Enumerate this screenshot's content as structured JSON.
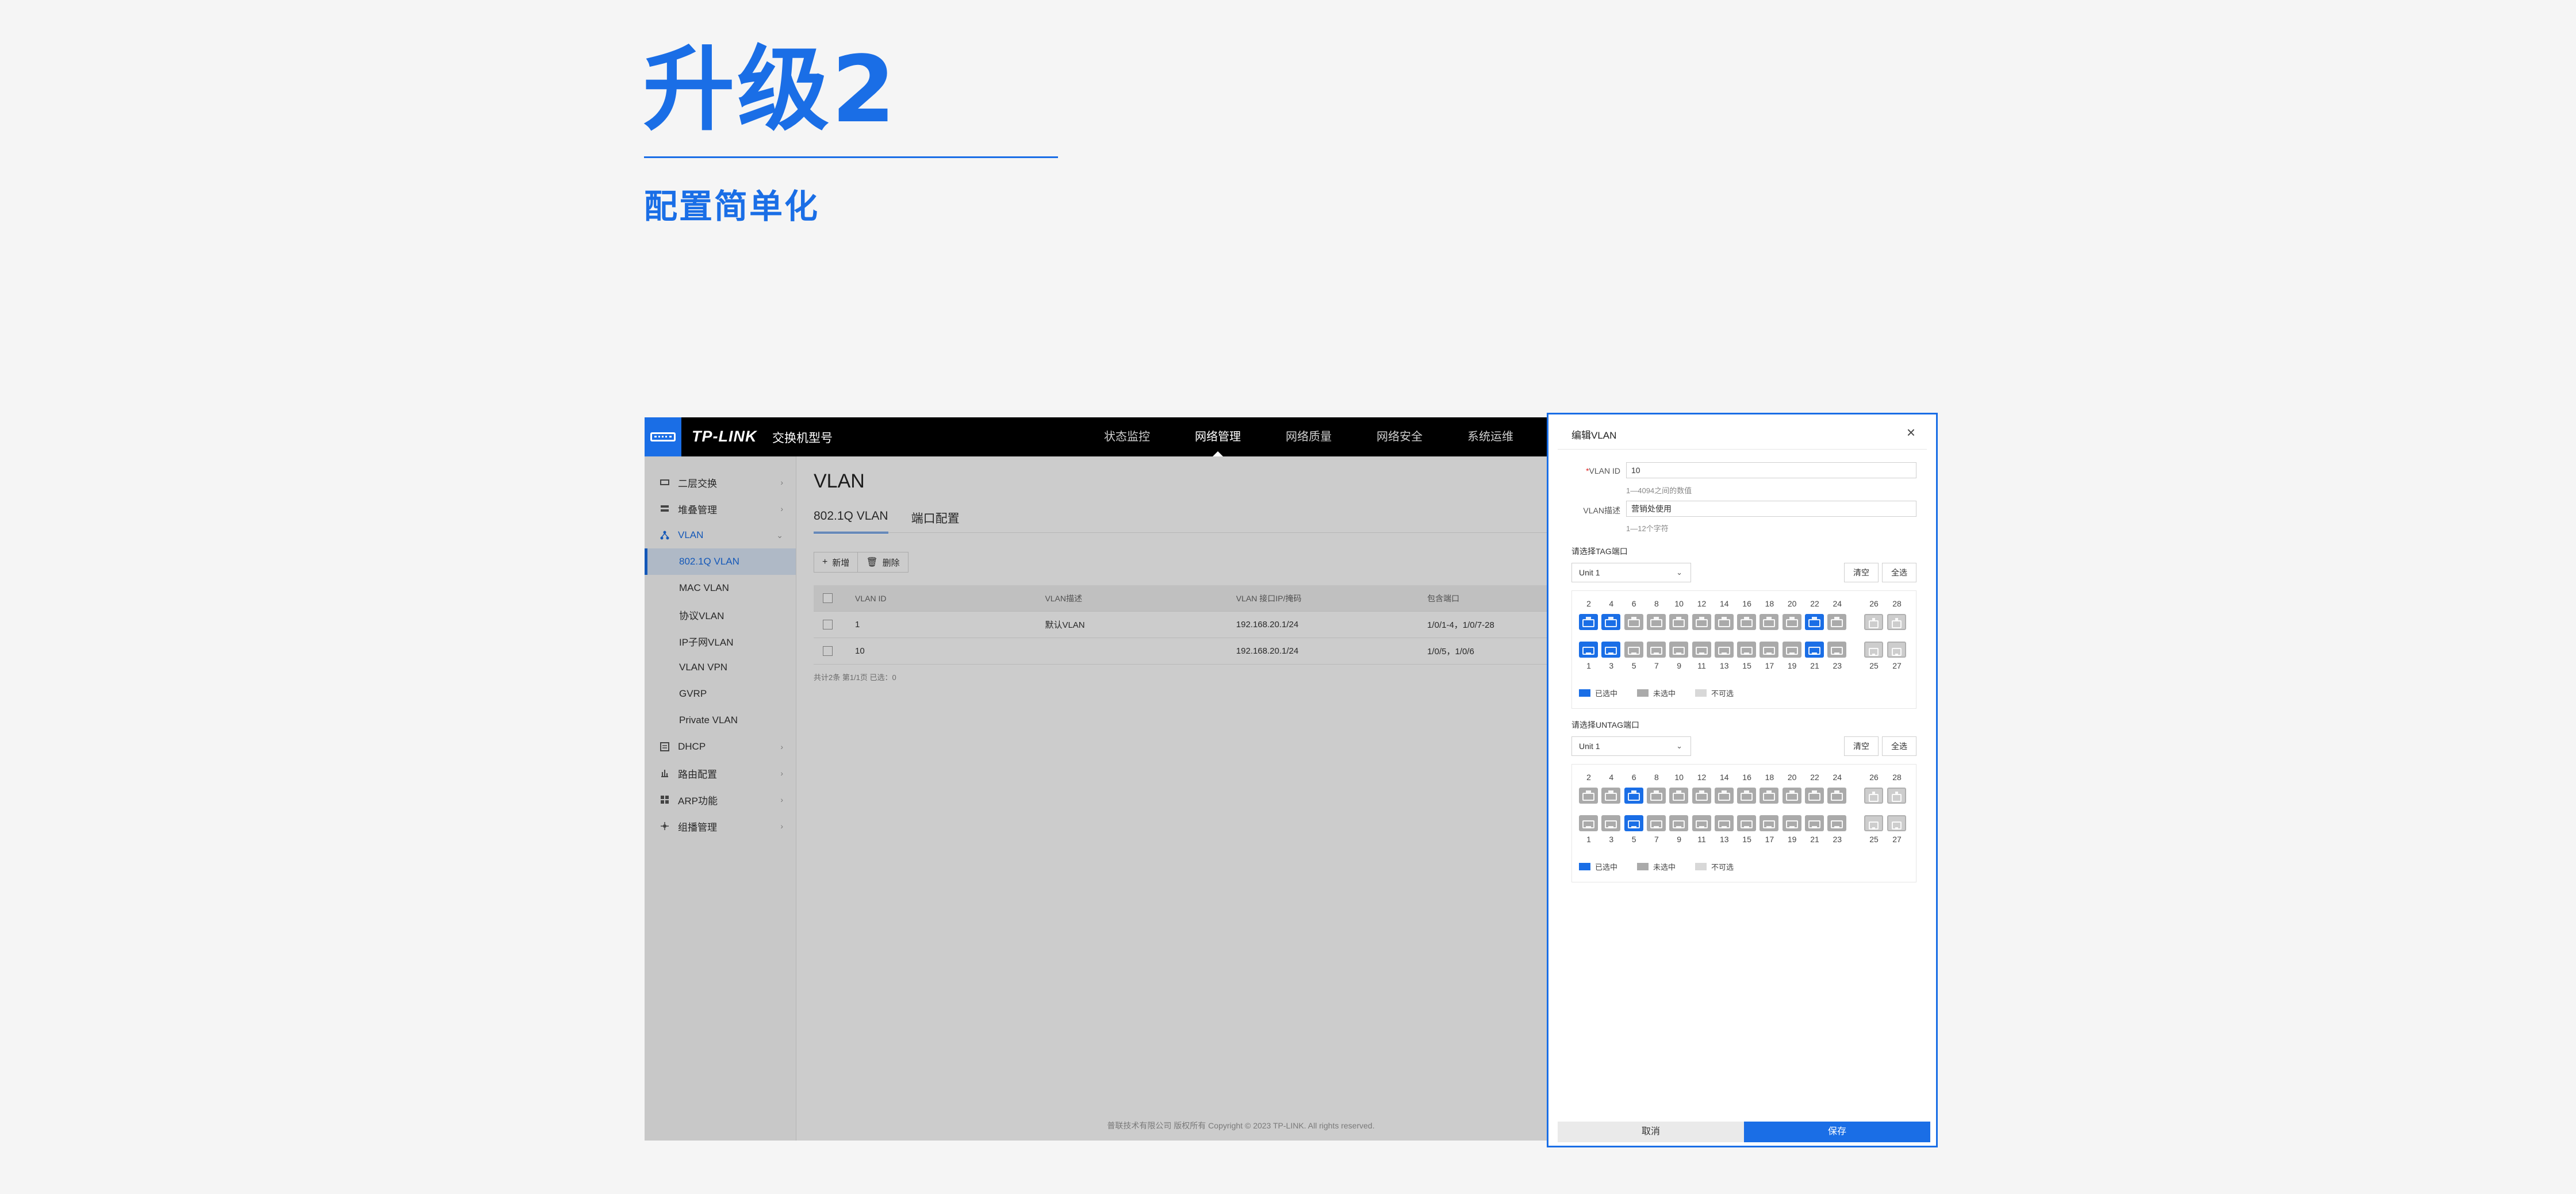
{
  "hero": {
    "title": "升级2",
    "subtitle": "配置简单化"
  },
  "header": {
    "brand": "TP-LINK",
    "model": "交换机型号",
    "nav": [
      "状态监控",
      "网络管理",
      "网络质量",
      "网络安全",
      "系统运维"
    ],
    "active_nav": "网络管理"
  },
  "sidebar": {
    "items": [
      {
        "label": "二层交换",
        "icon": "switch-icon"
      },
      {
        "label": "堆叠管理",
        "icon": "stack-icon"
      },
      {
        "label": "VLAN",
        "icon": "vlan-icon",
        "open": true,
        "children": [
          "802.1Q VLAN",
          "MAC VLAN",
          "协议VLAN",
          "IP子网VLAN",
          "VLAN VPN",
          "GVRP",
          "Private VLAN"
        ],
        "active_child": "802.1Q VLAN"
      },
      {
        "label": "DHCP",
        "icon": "dhcp-icon"
      },
      {
        "label": "路由配置",
        "icon": "route-icon"
      },
      {
        "label": "ARP功能",
        "icon": "arp-icon"
      },
      {
        "label": "组播管理",
        "icon": "multicast-icon"
      }
    ]
  },
  "main": {
    "title": "VLAN",
    "tabs": [
      "802.1Q VLAN",
      "端口配置"
    ],
    "add_label": "新增",
    "delete_label": "删除",
    "columns": [
      "VLAN ID",
      "VLAN描述",
      "VLAN 接口IP/掩码",
      "包含端口"
    ],
    "rows": [
      [
        "1",
        "默认VLAN",
        "192.168.20.1/24",
        "1/0/1-4，1/0/7-28"
      ],
      [
        "10",
        "",
        "192.168.20.1/24",
        "1/0/5，1/0/6"
      ]
    ],
    "table_footer": "共计2条   第1/1页    已选：0",
    "copyright": "普联技术有限公司 版权所有 Copyright © 2023 TP-LINK. All rights reserved."
  },
  "drawer": {
    "title": "编辑VLAN",
    "close": "×",
    "vlan_id_label": "VLAN ID",
    "vlan_id_value": "10",
    "vlan_id_hint": "1—4094之间的数值",
    "vlan_desc_label": "VLAN描述",
    "vlan_desc_value": "营销处使用",
    "vlan_desc_hint": "1—12个字符",
    "tag_title": "请选择TAG端口",
    "untag_title": "请选择UNTAG端口",
    "unit": "Unit 1",
    "clear_label": "清空",
    "all_label": "全选",
    "top_ports": [
      "2",
      "4",
      "6",
      "8",
      "10",
      "12",
      "14",
      "16",
      "18",
      "20",
      "22",
      "24"
    ],
    "bottom_ports": [
      "1",
      "3",
      "5",
      "7",
      "9",
      "11",
      "13",
      "15",
      "17",
      "19",
      "21",
      "23"
    ],
    "sfp_top": [
      "26",
      "28"
    ],
    "sfp_bottom": [
      "25",
      "27"
    ],
    "tag_selected": [
      "1",
      "2",
      "3",
      "4",
      "21",
      "22"
    ],
    "untag_selected": [
      "5",
      "6"
    ],
    "legend": [
      "已选中",
      "未选中",
      "不可选"
    ],
    "colors": {
      "selected": "#1a6ee6",
      "unselected": "#aaaaaa",
      "disabled": "#d8d8d8"
    },
    "cancel_label": "取消",
    "save_label": "保存"
  }
}
